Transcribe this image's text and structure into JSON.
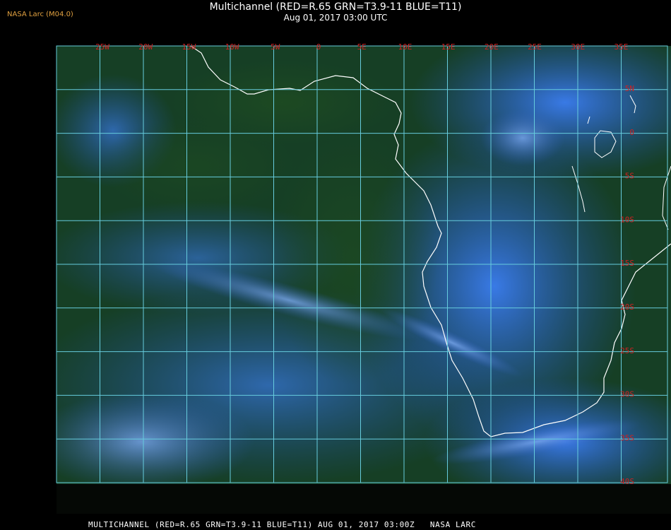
{
  "header": {
    "title": "Multichannel (RED=R.65 GRN=T3.9-11 BLUE=T11)",
    "datetime": "Aug 01, 2017 03:00 UTC",
    "badge": "NASA Larc (M04.0)"
  },
  "grid": {
    "longitude_labels": [
      "25W",
      "20W",
      "15W",
      "10W",
      "5W",
      "0",
      "5E",
      "10E",
      "15E",
      "20E",
      "25E",
      "30E",
      "35E"
    ],
    "latitude_labels": [
      "5N",
      "0",
      "5S",
      "10S",
      "15S",
      "20S",
      "25S",
      "30S",
      "35S",
      "40S"
    ]
  },
  "colors": {
    "grid": "#66ccdd",
    "label": "#cc2222",
    "coast": "#ffffff",
    "ocean": "#0f3a1f",
    "cloud": "#2f6fe0"
  },
  "footer": "MULTICHANNEL (RED=R.65 GRN=T3.9-11 BLUE=T11) AUG 01, 2017 03:00Z   NASA LARC"
}
